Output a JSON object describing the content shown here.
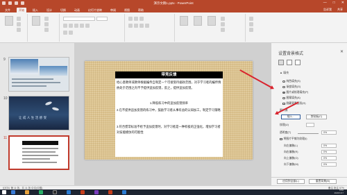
{
  "window": {
    "title": "演示文稿1.pptx - PowerPoint",
    "controls": [
      "—",
      "□",
      "✕"
    ]
  },
  "tabs": [
    "文件",
    "开始",
    "插入",
    "设计",
    "切换",
    "动画",
    "幻灯片放映",
    "审阅",
    "视图",
    "帮助"
  ],
  "tabs_right": [
    "告诉我",
    "共享"
  ],
  "slides": {
    "numbers": [
      "9",
      "10",
      "11"
    ],
    "t10_text": "让 成 人 生 活 感 受"
  },
  "slide": {
    "title": "带竞反馈",
    "p1": "给心意教师或教师根据编传自制定一个可接受待据政范围，对于学习者的编传情依处于范围之内不予提供追加反馈，反之，提供追加反馈。",
    "p2": "1.降低练习中的追加反馈频率",
    "p3": "2.在不提供追加反馈的练习中，鼓励学习者从事有益的认知加工，制定学习策略",
    "p4": "3.符合惯常标准不给予追加反馈时，对学习者是一种积极的正强化，增加学习者对技能模仿的可能性"
  },
  "format_pane": {
    "title": "设置背景格式",
    "close": "✕",
    "section": "▲ 填充",
    "options": [
      "纯色填充(S)",
      "渐变填充(G)",
      "图片或纹理填充(P)",
      "图案填充(A)",
      "隐藏背景图形(H)"
    ],
    "selected_option": "图片或纹理填充(P)",
    "image_source_label": "图片源",
    "insert_button": "插入...",
    "clipboard_button": "剪贴板(C)",
    "texture_label": "纹理(U)",
    "transparency_label": "透明度(T)",
    "transparency_value": "0%",
    "tile_checkbox": "将图片平铺为纹理(I)",
    "offset_left_label": "向左偏移(L)",
    "offset_right_label": "向右偏移(R)",
    "offset_top_label": "向上偏移(O)",
    "offset_bottom_label": "向下偏移(M)",
    "offset_value": "0%",
    "apply_all_button": "应用到全部(L)",
    "reset_button": "重置背景(B)"
  },
  "statusbar": {
    "left": "幻灯片 第 11 张，共 11 张   中文(中国)",
    "right": "备注   批注   57%"
  },
  "taskbar": {
    "time": "8:50",
    "date": "2020/1/17"
  },
  "colors": {
    "accent": "#b7472a",
    "annotation": "#d9232d",
    "slide_bg": "#dcc38f"
  }
}
